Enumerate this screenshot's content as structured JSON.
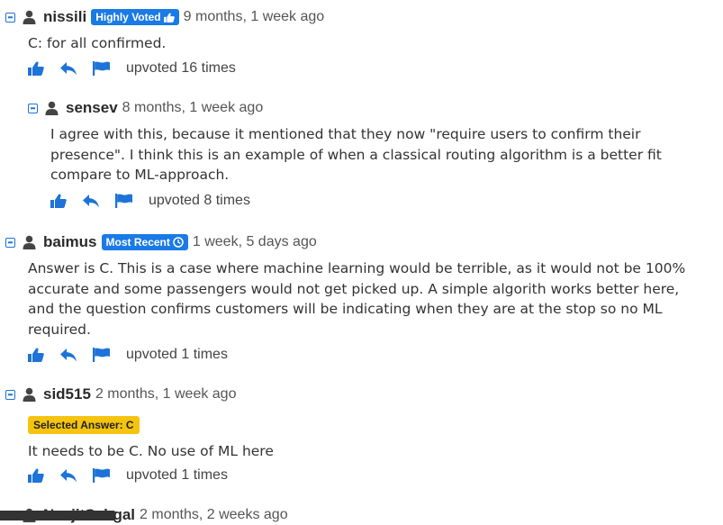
{
  "colors": {
    "accent": "#1e73d8",
    "badge": "#1a7ae6",
    "selected": "#f5c40f"
  },
  "comments": [
    {
      "username": "nissili",
      "badge": "Highly Voted",
      "badge_icon": "thumbs-up-icon",
      "time": "9 months, 1 week ago",
      "text": "C: for all confirmed.",
      "upvoted": "upvoted 16 times"
    },
    {
      "username": "sensev",
      "time": "8 months, 1 week ago",
      "text": "I agree with this, because it mentioned that they now \"require users to confirm their presence\". I think this is an example of when a classical routing algorithm is a better fit compare to ML-approach.",
      "upvoted": "upvoted 8 times"
    },
    {
      "username": "baimus",
      "badge": "Most Recent",
      "badge_icon": "clock-icon",
      "time": "1 week, 5 days ago",
      "text": "Answer is C. This is a case where machine learning would be terrible, as it would not be 100% accurate and some passengers would not get picked up. A simple algorith works better here, and the question confirms customers will be indicating when they are at the stop so no ML required.",
      "upvoted": "upvoted 1 times"
    },
    {
      "username": "sid515",
      "time": "2 months, 1 week ago",
      "selected_answer": "Selected Answer: C",
      "text": "It needs to be C. No use of ML here",
      "upvoted": "upvoted 1 times"
    },
    {
      "username": "NavjitSehgal",
      "time": "2 months, 2 weeks ago"
    }
  ]
}
